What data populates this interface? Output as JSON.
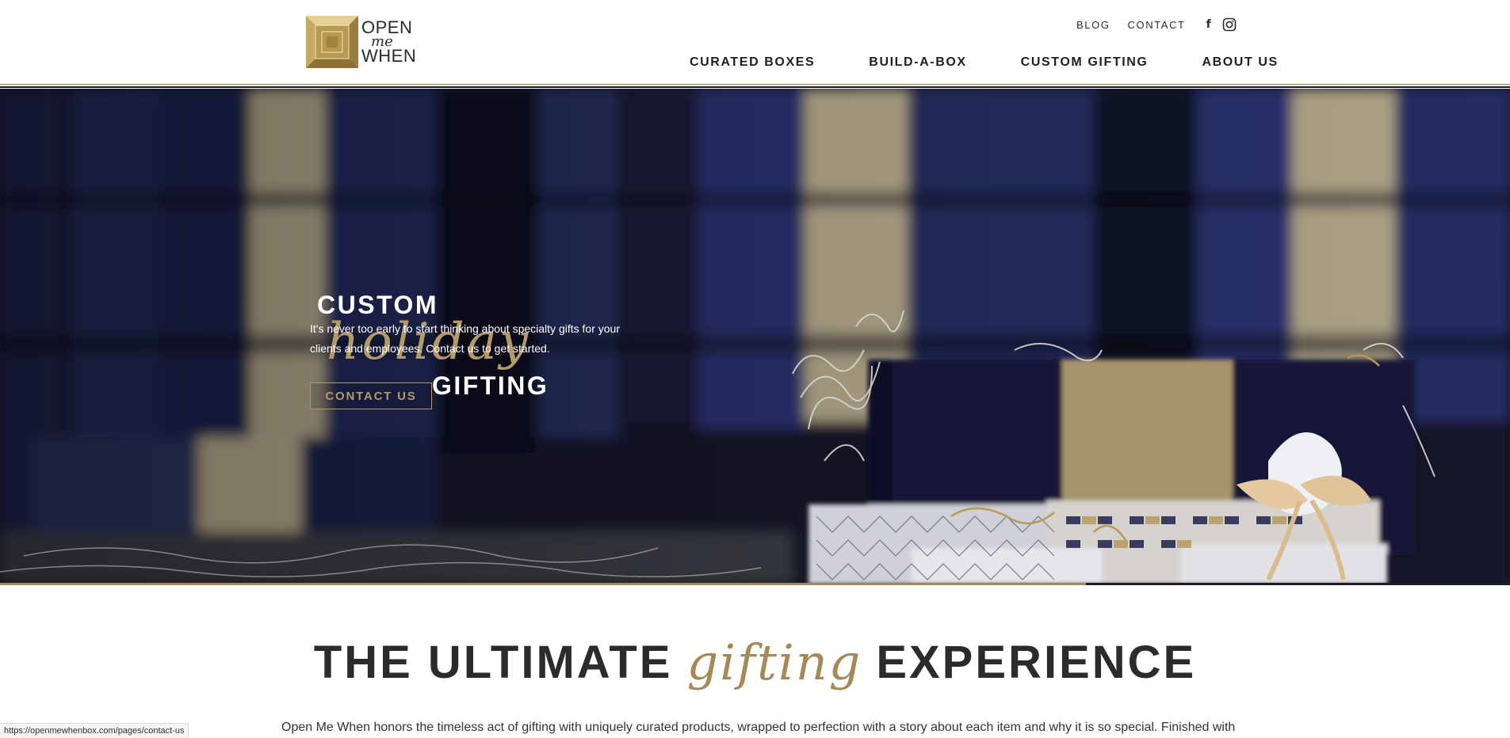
{
  "header": {
    "logo": {
      "line1": "OPEN",
      "line2": "me",
      "line3": "WHEN"
    },
    "utility_nav": [
      {
        "label": "BLOG"
      },
      {
        "label": "CONTACT"
      }
    ],
    "social": {
      "facebook_glyph": "f"
    },
    "main_nav": [
      {
        "label": "CURATED BOXES"
      },
      {
        "label": "BUILD-A-BOX"
      },
      {
        "label": "CUSTOM GIFTING"
      },
      {
        "label": "ABOUT US"
      }
    ]
  },
  "hero": {
    "title_line1": "CUSTOM",
    "title_script": "holiday",
    "title_line3": "GIFTING",
    "copy": "It's never too early to start thinking about specialty gifts for your clients and employees. Contact us to get started.",
    "cta_label": "CONTACT US"
  },
  "section": {
    "title_a": "THE ULTIMATE",
    "title_script": "gifting",
    "title_c": "EXPERIENCE",
    "copy": "Open Me When honors the timeless act of gifting with uniquely curated products, wrapped to perfection with a story about each item and why it is so special. Finished with"
  },
  "status_bar": {
    "url": "https://openmewhenbox.com/pages/contact-us"
  },
  "colors": {
    "gold": "#a58a57",
    "navy": "#171b33",
    "text": "#2b2b2b"
  },
  "icons": [
    "logo-box-icon",
    "facebook-icon",
    "instagram-icon"
  ]
}
